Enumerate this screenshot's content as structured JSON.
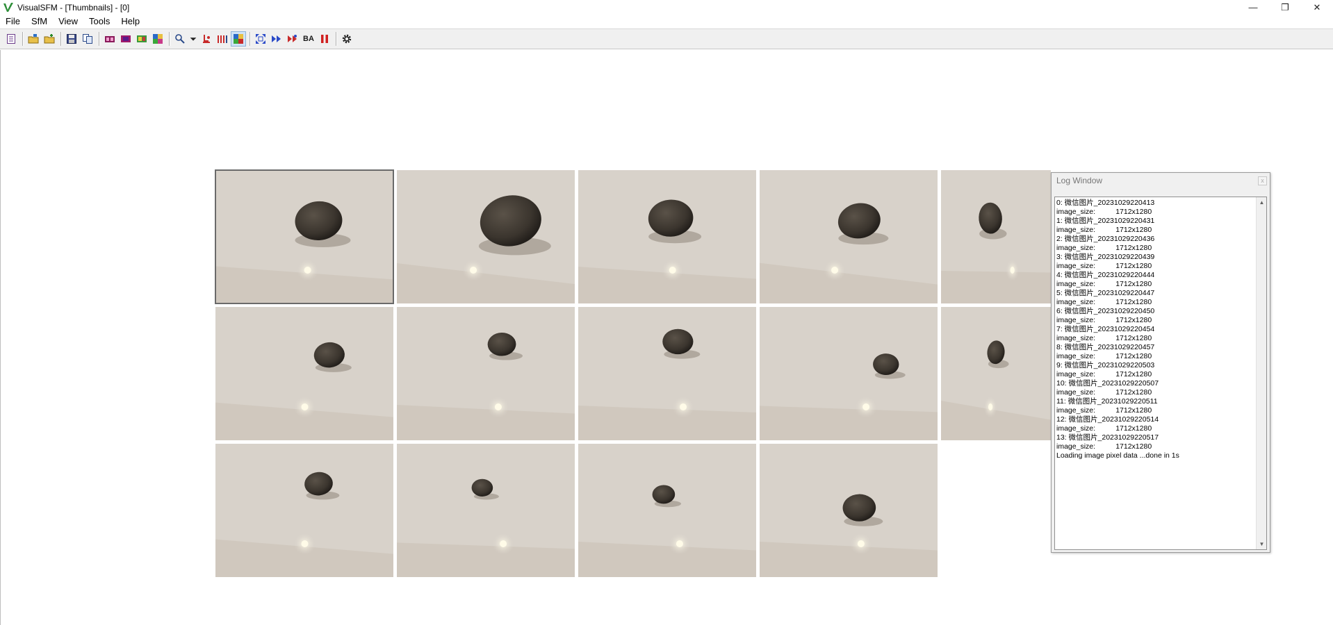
{
  "window": {
    "title": "VisualSFM - [Thumbnails] - [0]",
    "controls": {
      "minimize": "—",
      "restore": "❐",
      "close": "✕"
    }
  },
  "menu": [
    {
      "name": "menu-file",
      "label": "File"
    },
    {
      "name": "menu-sfm",
      "label": "SfM"
    },
    {
      "name": "menu-view",
      "label": "View"
    },
    {
      "name": "menu-tools",
      "label": "Tools"
    },
    {
      "name": "menu-help",
      "label": "Help"
    }
  ],
  "toolbar": {
    "ba_label": "BA",
    "icons": [
      "log-window-icon",
      "open-multi-images-icon",
      "add-images-icon",
      "save-nvm-icon",
      "copy-icon",
      "show-thumbnails-icon",
      "show-matches-icon",
      "show-feature-icon",
      "show-matrix-icon",
      "zoom-icon",
      "dropdown-icon",
      "compute-missing-match-icon",
      "match-matrix-icon",
      "sfm-mode-icon",
      "fit-view-icon",
      "compute-3d-reconstruction-icon",
      "compute-dense-icon",
      "bundle-adjustment-icon",
      "pause-icon",
      "settings-icon"
    ]
  },
  "thumbnails": {
    "selected_index": 0,
    "count": 14
  },
  "log": {
    "title": "Log Window",
    "close_label": "x",
    "scroll_up": "▲",
    "scroll_down": "▼",
    "lines": [
      "0: 微信图片_20231029220413",
      "image_size:          1712x1280",
      "1: 微信图片_20231029220431",
      "image_size:          1712x1280",
      "2: 微信图片_20231029220436",
      "image_size:          1712x1280",
      "3: 微信图片_20231029220439",
      "image_size:          1712x1280",
      "4: 微信图片_20231029220444",
      "image_size:          1712x1280",
      "5: 微信图片_20231029220447",
      "image_size:          1712x1280",
      "6: 微信图片_20231029220450",
      "image_size:          1712x1280",
      "7: 微信图片_20231029220454",
      "image_size:          1712x1280",
      "8: 微信图片_20231029220457",
      "image_size:          1712x1280",
      "9: 微信图片_20231029220503",
      "image_size:          1712x1280",
      "10: 微信图片_20231029220507",
      "image_size:          1712x1280",
      "11: 微信图片_20231029220511",
      "image_size:          1712x1280",
      "12: 微信图片_20231029220514",
      "image_size:          1712x1280",
      "13: 微信图片_20231029220517",
      "image_size:          1712x1280",
      "Loading image pixel data ...done in 1s"
    ]
  },
  "colors": {
    "surface": "#d8d2ca",
    "surface_shadow": "#c2b8aa",
    "stone": "#3b352e",
    "stone_dark": "#231f1b",
    "glare": "#fffbe8"
  }
}
